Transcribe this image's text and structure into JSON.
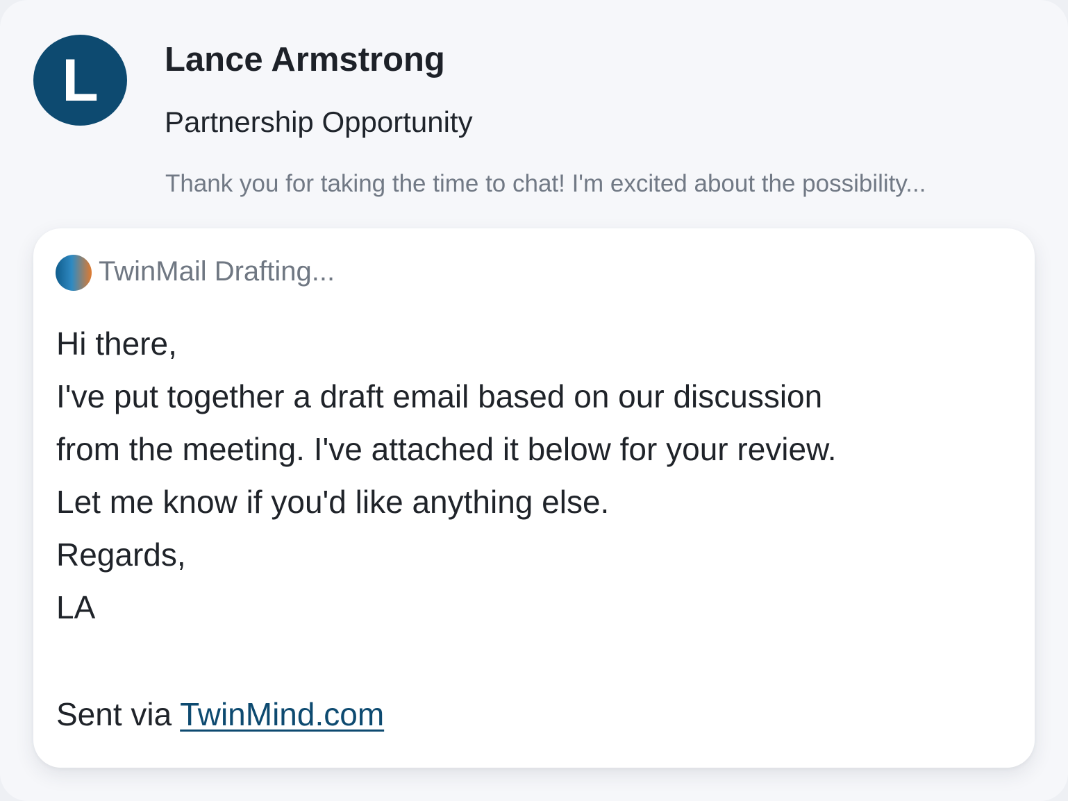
{
  "email": {
    "avatar_initial": "L",
    "sender": "Lance Armstrong",
    "subject": "Partnership Opportunity",
    "preview": "Thank you for taking the time to chat! I'm excited about the possibility..."
  },
  "draft": {
    "status_label": "TwinMail Drafting...",
    "lines": [
      "Hi there,",
      "I've put together a draft email based on our discussion",
      "from the meeting. I've attached it below for your review.",
      "Let me know if you'd like anything else.",
      "Regards,",
      "LA"
    ],
    "footer_prefix": "Sent via ",
    "footer_link": "TwinMind.com"
  },
  "colors": {
    "avatar": "#0d4a70",
    "link": "#0d4a70",
    "background": "#f6f7fa",
    "card": "#ffffff"
  },
  "icons": {
    "drafting": "twinmail-gradient-icon"
  }
}
